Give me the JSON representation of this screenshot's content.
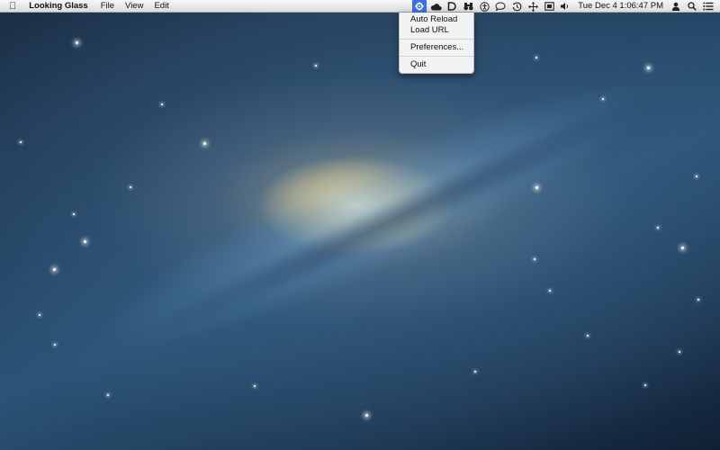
{
  "menubar": {
    "app_name": "Looking Glass",
    "menus": [
      "File",
      "View",
      "Edit"
    ],
    "status_icons": [
      "looking-glass-gear",
      "cloud",
      "d-app",
      "binoculars",
      "accessibility",
      "chat-bubble",
      "time-machine",
      "network-arrows",
      "display",
      "volume"
    ],
    "clock": "Tue Dec 4  1:06:47 PM"
  },
  "dropdown": {
    "items": [
      "Auto Reload",
      "Load URL",
      "Preferences...",
      "Quit"
    ]
  },
  "colors": {
    "menu_highlight": "#3d6fe0",
    "menubar_bg": "#e8e8e8"
  }
}
